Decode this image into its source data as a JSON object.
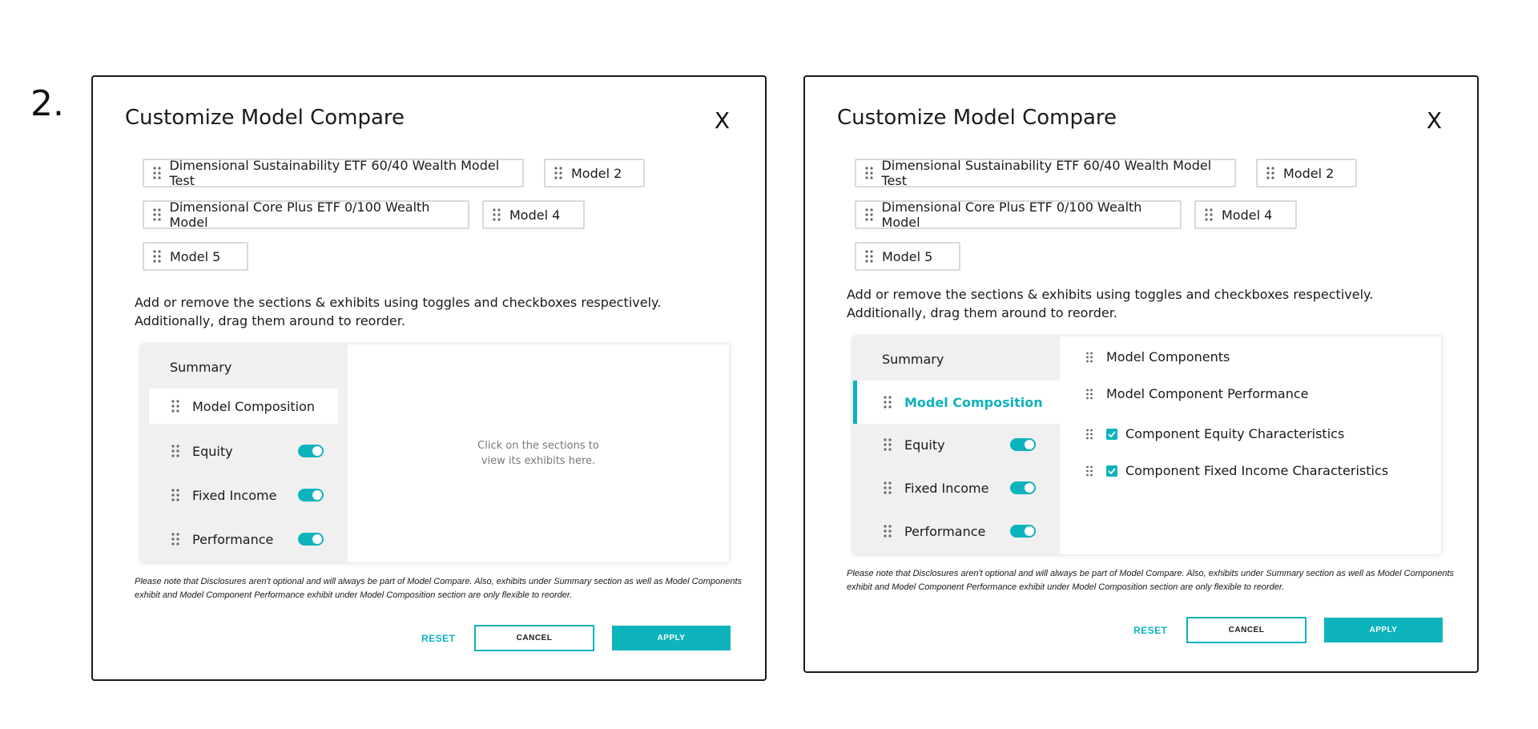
{
  "step_label": "2.",
  "colors": {
    "accent": "#0db3bd",
    "panel_bg": "#f0f0f0",
    "border": "#1a1a1a"
  },
  "icons": {
    "close": "x",
    "drag": "drag-handle-icon",
    "check": "check-icon"
  },
  "dialogs": [
    {
      "title": "Customize Model Compare",
      "close": "X",
      "models": [
        "Dimensional Sustainability ETF 60/40 Wealth Model Test",
        "Model 2",
        "Dimensional Core Plus ETF 0/100 Wealth Model",
        "Model 4",
        "Model 5"
      ],
      "instructions": "Add or remove the sections & exhibits using toggles and checkboxes respectively. Additionally, drag them around to reorder.",
      "sections": {
        "summary": "Summary",
        "items": [
          "Model Composition",
          "Equity",
          "Fixed Income",
          "Performance"
        ]
      },
      "placeholder": "Click on the sections to view its exhibits here.",
      "note": "Please note that Disclosures aren't optional and will always be part of Model Compare. Also, exhibits under Summary section as well as Model Components exhibit and Model Component Performance exhibit under Model Composition section are only flexible to reorder.",
      "buttons": {
        "reset": "RESET",
        "cancel": "CANCEL",
        "apply": "APPLY"
      }
    },
    {
      "title": "Customize Model Compare",
      "close": "X",
      "models": [
        "Dimensional Sustainability ETF 60/40 Wealth Model Test",
        "Model 2",
        "Dimensional Core Plus ETF 0/100 Wealth Model",
        "Model 4",
        "Model 5"
      ],
      "instructions": "Add or remove the sections & exhibits using toggles and checkboxes respectively. Additionally, drag them around to reorder.",
      "sections": {
        "summary": "Summary",
        "items": [
          "Model Composition",
          "Equity",
          "Fixed Income",
          "Performance"
        ]
      },
      "exhibits": [
        {
          "label": "Model Components",
          "checkbox": false
        },
        {
          "label": "Model Component Performance",
          "checkbox": false
        },
        {
          "label": "Component Equity Characteristics",
          "checkbox": true,
          "checked": true
        },
        {
          "label": "Component Fixed Income Characteristics",
          "checkbox": true,
          "checked": true
        }
      ],
      "note": "Please note that Disclosures aren't optional and will always be part of Model Compare. Also, exhibits under Summary section as well as Model Components exhibit and Model Component Performance exhibit under Model Composition section are only flexible to reorder.",
      "buttons": {
        "reset": "RESET",
        "cancel": "CANCEL",
        "apply": "APPLY"
      }
    }
  ]
}
